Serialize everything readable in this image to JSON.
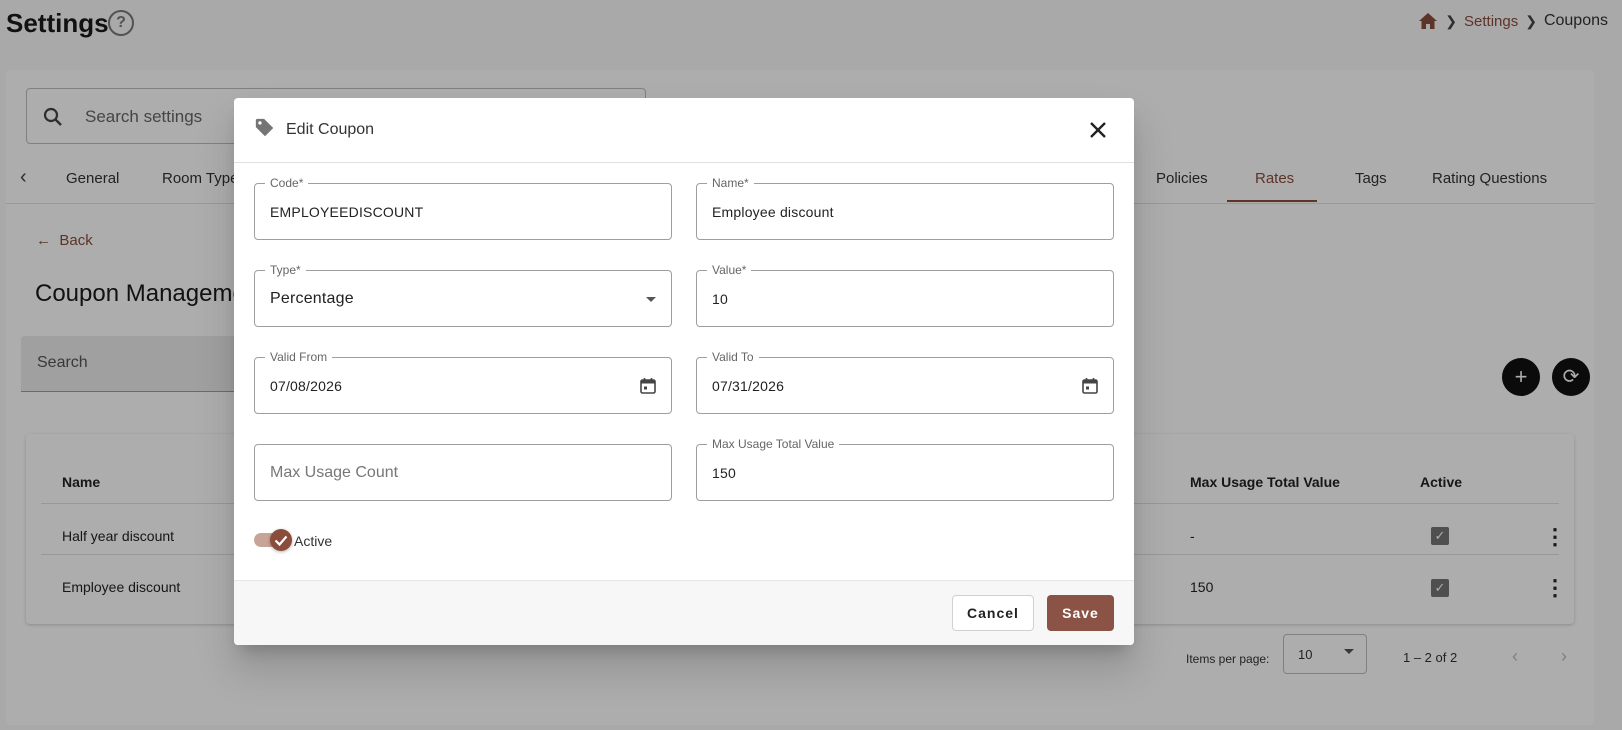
{
  "page": {
    "title": "Settings",
    "help_icon": "help-circle-icon",
    "breadcrumb": {
      "home_icon": "home-icon",
      "settings": "Settings",
      "current": "Coupons"
    }
  },
  "settings_search": {
    "placeholder": "Search settings"
  },
  "tabs": {
    "items": [
      "General",
      "Room Types",
      "Policies",
      "Rates",
      "Tags",
      "Rating Questions"
    ],
    "active": "Rates"
  },
  "coupons": {
    "back_label": "Back",
    "section_title": "Coupon Management",
    "search_placeholder": "Search",
    "table": {
      "headers": {
        "name": "Name",
        "max_usage_total_value": "Max Usage Total Value",
        "active": "Active"
      },
      "rows": [
        {
          "name": "Half year discount",
          "max_usage_total_value": "-",
          "active": true
        },
        {
          "name": "Employee discount",
          "max_usage_total_value": "150",
          "active": true
        }
      ]
    },
    "paginator": {
      "items_per_page_label": "Items per page:",
      "page_size": "10",
      "range": "1 – 2 of 2"
    }
  },
  "dialog": {
    "title": "Edit Coupon",
    "icon": "tag-icon",
    "fields": {
      "code": {
        "label": "Code*",
        "value": "EMPLOYEEDISCOUNT"
      },
      "name": {
        "label": "Name*",
        "value": "Employee discount"
      },
      "type": {
        "label": "Type*",
        "value": "Percentage"
      },
      "value": {
        "label": "Value*",
        "value": "10"
      },
      "valid_from": {
        "label": "Valid From",
        "value": "07/08/2026"
      },
      "valid_to": {
        "label": "Valid To",
        "value": "07/31/2026"
      },
      "max_usage_count": {
        "placeholder": "Max Usage Count"
      },
      "max_usage_total_value": {
        "label": "Max Usage Total Value",
        "value": "150"
      }
    },
    "active": {
      "label": "Active",
      "checked": true
    },
    "buttons": {
      "cancel": "Cancel",
      "save": "Save"
    }
  },
  "colors": {
    "accent": "#8a4d3c",
    "save_button": "#8a5346",
    "toggle_track": "#c8a397",
    "overlay": "rgba(0,0,0,0.32)"
  }
}
